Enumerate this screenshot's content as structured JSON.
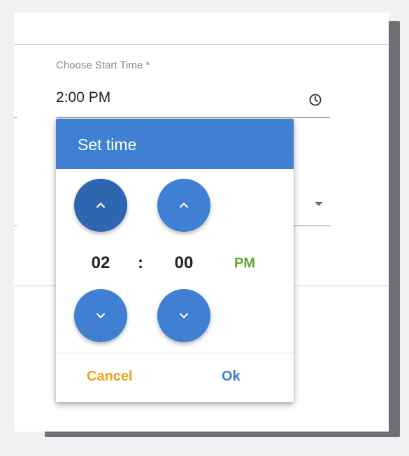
{
  "start_time_field": {
    "label": "Choose Start Time *",
    "value": "2:00 PM",
    "icon": "clock-icon"
  },
  "secondary_field": {
    "icon": "dropdown-arrow-icon"
  },
  "time_picker": {
    "title": "Set time",
    "hour": "02",
    "separator": ":",
    "minute": "00",
    "period": "PM",
    "cancel_label": "Cancel",
    "ok_label": "Ok",
    "icons": {
      "increment": "chevron-up-icon",
      "decrement": "chevron-down-icon"
    },
    "colors": {
      "accent": "#3f80d3",
      "accent_pressed": "#2f66b0",
      "period": "#5aa83a",
      "cancel": "#f2a21d"
    }
  }
}
